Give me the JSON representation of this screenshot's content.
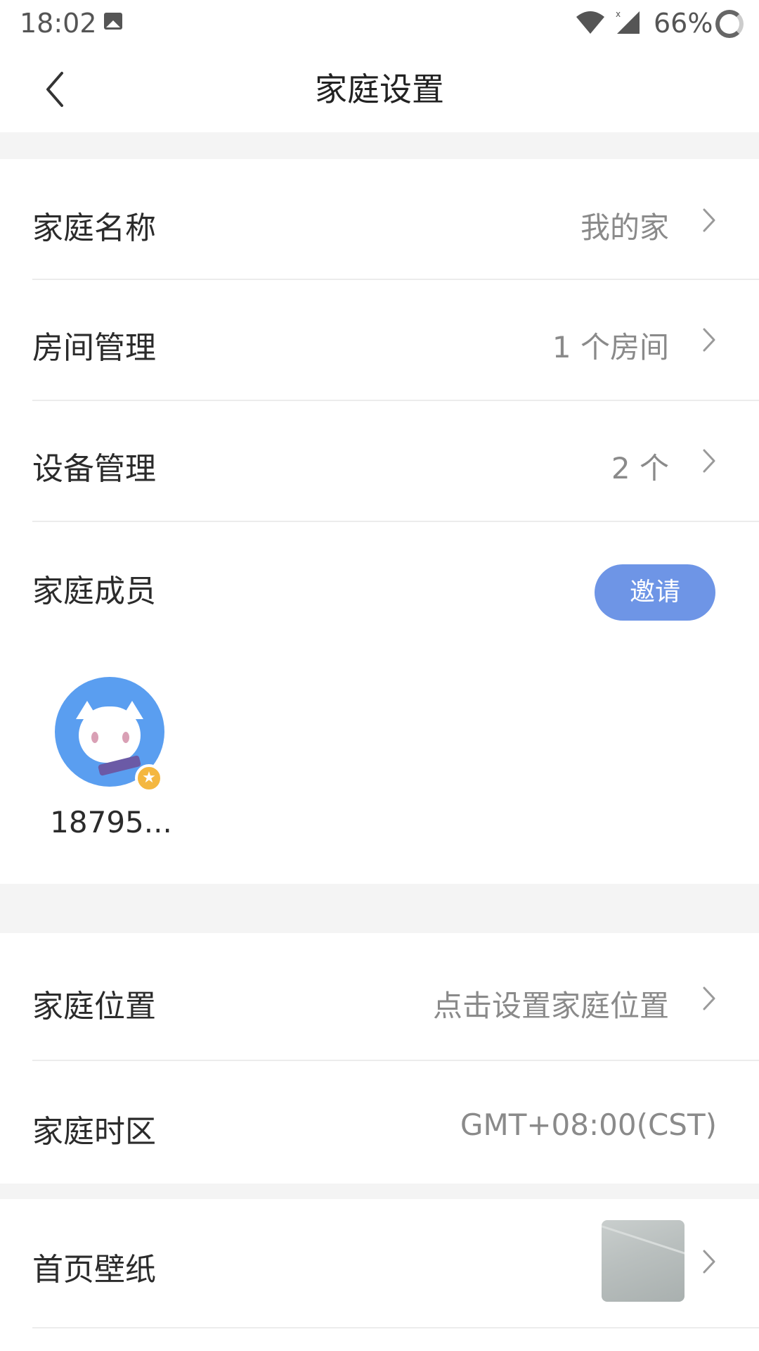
{
  "status_bar": {
    "time": "18:02",
    "battery": "66%",
    "icons": [
      "image-icon",
      "wifi-icon",
      "signal-icon",
      "battery-ring-icon"
    ]
  },
  "header": {
    "title": "家庭设置",
    "back_icon": "chevron-left-icon"
  },
  "settings": {
    "home_name": {
      "label": "家庭名称",
      "value": "我的家"
    },
    "room_management": {
      "label": "房间管理",
      "value": "1 个房间"
    },
    "device_management": {
      "label": "设备管理",
      "value": "2 个"
    },
    "members": {
      "label": "家庭成员",
      "invite_label": "邀请",
      "list": [
        {
          "name": "18795...",
          "is_owner": true
        }
      ]
    },
    "location": {
      "label": "家庭位置",
      "value": "点击设置家庭位置"
    },
    "timezone": {
      "label": "家庭时区",
      "value": "GMT+08:00(CST)"
    },
    "wallpaper": {
      "label": "首页壁纸"
    }
  },
  "colors": {
    "invite_button": "#6e95e6",
    "avatar_bg": "#5a9ef0",
    "owner_badge": "#f4b740",
    "section_gap": "#f4f4f4"
  }
}
